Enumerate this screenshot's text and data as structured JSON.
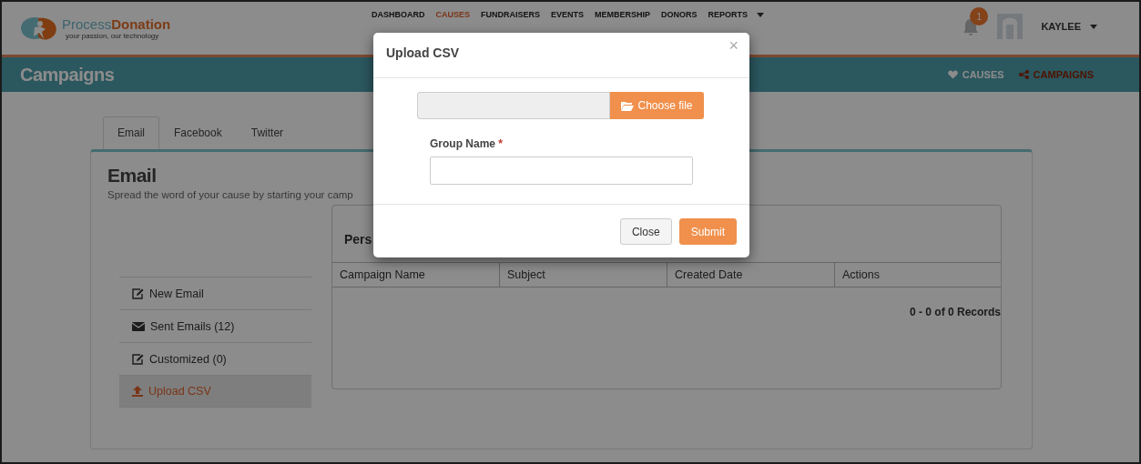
{
  "header": {
    "logo": {
      "first": "Process",
      "second": "Donation",
      "tagline": "your passion, our technology"
    },
    "nav": [
      {
        "label": "DASHBOARD",
        "selected": false,
        "dropdown": false
      },
      {
        "label": "CAUSES",
        "selected": true,
        "dropdown": false
      },
      {
        "label": "FUNDRAISERS",
        "selected": false,
        "dropdown": false
      },
      {
        "label": "EVENTS",
        "selected": false,
        "dropdown": false
      },
      {
        "label": "MEMBERSHIP",
        "selected": false,
        "dropdown": false
      },
      {
        "label": "DONORS",
        "selected": false,
        "dropdown": false
      },
      {
        "label": "REPORTS",
        "selected": false,
        "dropdown": true
      }
    ],
    "notifications": "1",
    "user": "KAYLEE"
  },
  "subheader": {
    "title": "Campaigns",
    "links": [
      {
        "label": "CAUSES",
        "selected": false
      },
      {
        "label": "CAMPAIGNS",
        "selected": true
      }
    ]
  },
  "tabs": [
    {
      "label": "Email",
      "selected": true
    },
    {
      "label": "Facebook",
      "selected": false
    },
    {
      "label": "Twitter",
      "selected": false
    }
  ],
  "panel": {
    "title": "Email",
    "description": "Spread the word of your cause by starting your camp",
    "sidebar": [
      {
        "label": "New Email",
        "selected": false
      },
      {
        "label": "Sent Emails (12)",
        "selected": false
      },
      {
        "label": "Customized (0)",
        "selected": false
      },
      {
        "label": "Upload CSV",
        "selected": true
      }
    ],
    "table": {
      "title": "Pers",
      "columns": [
        "Campaign Name",
        "Subject",
        "Created Date",
        "Actions"
      ],
      "pager": "0 - 0 of 0 Records"
    }
  },
  "modal": {
    "title": "Upload CSV",
    "close": "×",
    "file_button": "Choose file",
    "field_label": "Group Name",
    "required": "*",
    "buttons": [
      {
        "label": "Close",
        "kind": "default"
      },
      {
        "label": "Submit",
        "kind": "primary"
      }
    ]
  }
}
